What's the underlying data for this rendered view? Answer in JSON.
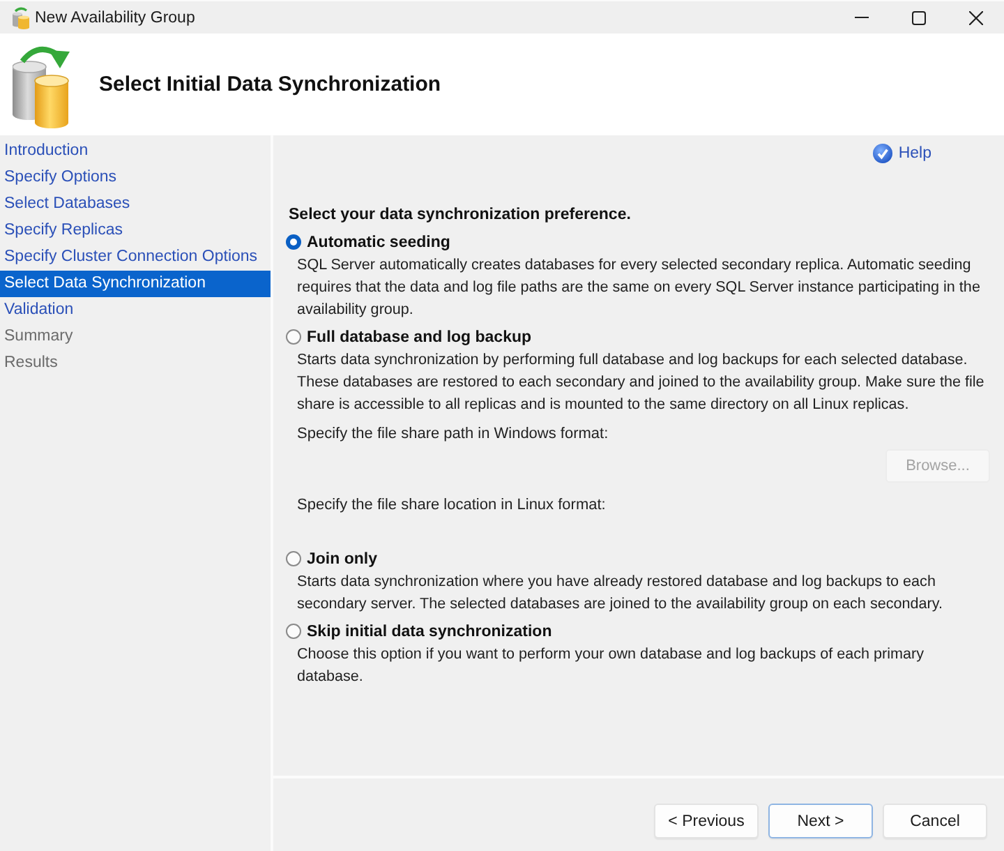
{
  "window": {
    "title": "New Availability Group"
  },
  "header": {
    "title": "Select Initial Data Synchronization"
  },
  "sidebar": {
    "items": [
      {
        "label": "Introduction",
        "selected": false,
        "disabled": false
      },
      {
        "label": "Specify Options",
        "selected": false,
        "disabled": false
      },
      {
        "label": "Select Databases",
        "selected": false,
        "disabled": false
      },
      {
        "label": "Specify Replicas",
        "selected": false,
        "disabled": false
      },
      {
        "label": "Specify Cluster Connection Options",
        "selected": false,
        "disabled": false
      },
      {
        "label": "Select Data Synchronization",
        "selected": true,
        "disabled": false
      },
      {
        "label": "Validation",
        "selected": false,
        "disabled": false
      },
      {
        "label": "Summary",
        "selected": false,
        "disabled": true
      },
      {
        "label": "Results",
        "selected": false,
        "disabled": true
      }
    ]
  },
  "help": {
    "label": "Help"
  },
  "prompt": "Select your data synchronization preference.",
  "options": [
    {
      "label": "Automatic seeding",
      "selected": true,
      "description": "SQL Server automatically creates databases for every selected secondary replica. Automatic seeding requires that the data and log file paths are the same on every SQL Server instance participating in the availability group."
    },
    {
      "label": "Full database and log backup",
      "selected": false,
      "description": "Starts data synchronization by performing full database and log backups for each selected database. These databases are restored to each secondary and joined to the availability group. Make sure the file share is accessible to all replicas and is mounted to the same directory on all Linux replicas.",
      "fields": [
        {
          "label": "Specify the file share path in Windows format:",
          "button": {
            "label": "Browse...",
            "disabled": true
          }
        },
        {
          "label": "Specify the file share location in Linux format:"
        }
      ]
    },
    {
      "label": "Join only",
      "selected": false,
      "description": "Starts data synchronization where you have already restored database and log backups to each secondary server. The selected databases are joined to the availability group on each secondary."
    },
    {
      "label": "Skip initial data synchronization",
      "selected": false,
      "description": "Choose this option if you want to perform your own database and log backups of each primary database."
    }
  ],
  "buttons": [
    {
      "label": "< Previous",
      "default": false
    },
    {
      "label": "Next >",
      "default": true
    },
    {
      "label": "Cancel",
      "default": false
    }
  ]
}
